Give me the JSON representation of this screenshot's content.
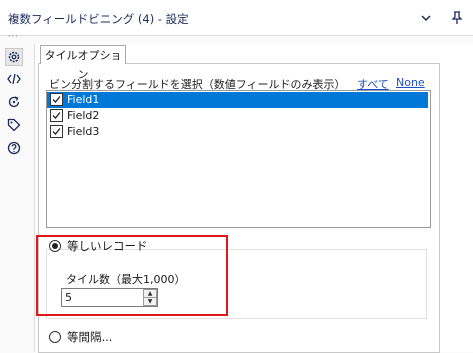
{
  "window": {
    "title": "複数フィールドビニング (4) - 設定"
  },
  "sidebar": {
    "items": [
      {
        "icon": "gear-icon"
      },
      {
        "icon": "code-icon"
      },
      {
        "icon": "refresh-icon"
      },
      {
        "icon": "tag-icon"
      },
      {
        "icon": "help-icon"
      }
    ]
  },
  "tab": {
    "label": "タイルオプション"
  },
  "field_select": {
    "label": "ビン分割するフィールドを選択（数値フィールドのみ表示）",
    "all_link": "すべて",
    "none_link": "None",
    "items": [
      {
        "name": "Field1",
        "checked": true,
        "selected": true
      },
      {
        "name": "Field2",
        "checked": true,
        "selected": false
      },
      {
        "name": "Field3",
        "checked": true,
        "selected": false
      }
    ]
  },
  "mode": {
    "equal_records_label": "等しいレコード",
    "tile_count_label": "タイル数（最大1,000）",
    "tile_count_value": "5",
    "equal_interval_label": "等間隔..."
  },
  "colors": {
    "selection": "#0078d7",
    "highlight": "#e01818",
    "link": "#1f4fbf"
  }
}
